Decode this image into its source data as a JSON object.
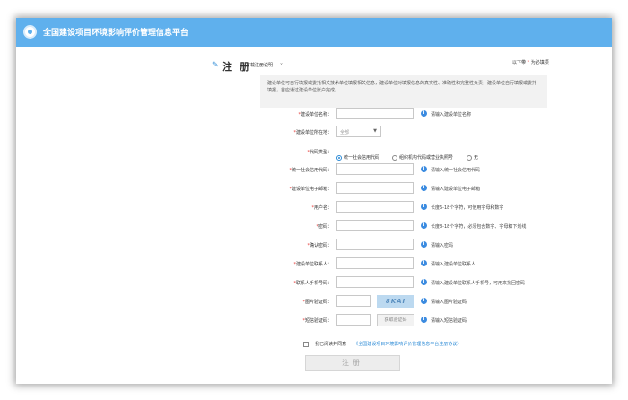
{
  "header": {
    "title": "全国建设项目环境影响评价管理信息平台"
  },
  "register": {
    "title": "注 册",
    "guide_link": "下载注册说明",
    "guide_x": "x",
    "required_note_prefix": "以下带",
    "required_star": "*",
    "required_note_suffix": "为必填项",
    "notice": "建设单位可自行填报或委托相关技术单位填报相关信息，建设单位对填报信息的真实性、准确性和完整性负责；建设单位自行填报或委托填报，首应通过建设单位账户完成。"
  },
  "form": {
    "company_name": {
      "label": "建设单位名称：",
      "hint": "请输入建设单位名称"
    },
    "location": {
      "label": "建设单位所在地：",
      "value": "全部"
    },
    "code_type": {
      "label": "代码类型：",
      "options": [
        "统一社会信用代码",
        "组织机构代码或营业执照号",
        "无"
      ],
      "selected": 0
    },
    "credit_code": {
      "label": "统一社会信用代码：",
      "hint": "请输入统一社会信用代码"
    },
    "email": {
      "label": "建设单位电子邮箱：",
      "hint": "请输入建设单位电子邮箱"
    },
    "username": {
      "label": "用户名：",
      "hint": "长度6-18个字符，可使用字母和数字"
    },
    "password": {
      "label": "密码：",
      "hint": "长度8-18个字符，必须包含数字、字母和下划线"
    },
    "confirm_password": {
      "label": "确认密码：",
      "hint": "请输入密码"
    },
    "contact": {
      "label": "建设单位联系人：",
      "hint": "请输入建设单位联系人"
    },
    "phone": {
      "label": "联系人手机号码：",
      "hint": "请输入建设单位联系人手机号，可用来找回密码"
    },
    "captcha": {
      "label": "图片验证码：",
      "image_text": "8KAI",
      "hint": "请输入图片验证码"
    },
    "sms": {
      "label": "短信验证码：",
      "button": "获取验证码",
      "hint": "请输入短信验证码"
    },
    "agree": {
      "text": "我已阅读并同意",
      "link": "《全国建设项目环境影响评价管理信息平台注册协议》"
    },
    "submit": "注册"
  },
  "colors": {
    "header": "#5fb0ed",
    "accent": "#2b8ad6",
    "required": "#e53935"
  }
}
